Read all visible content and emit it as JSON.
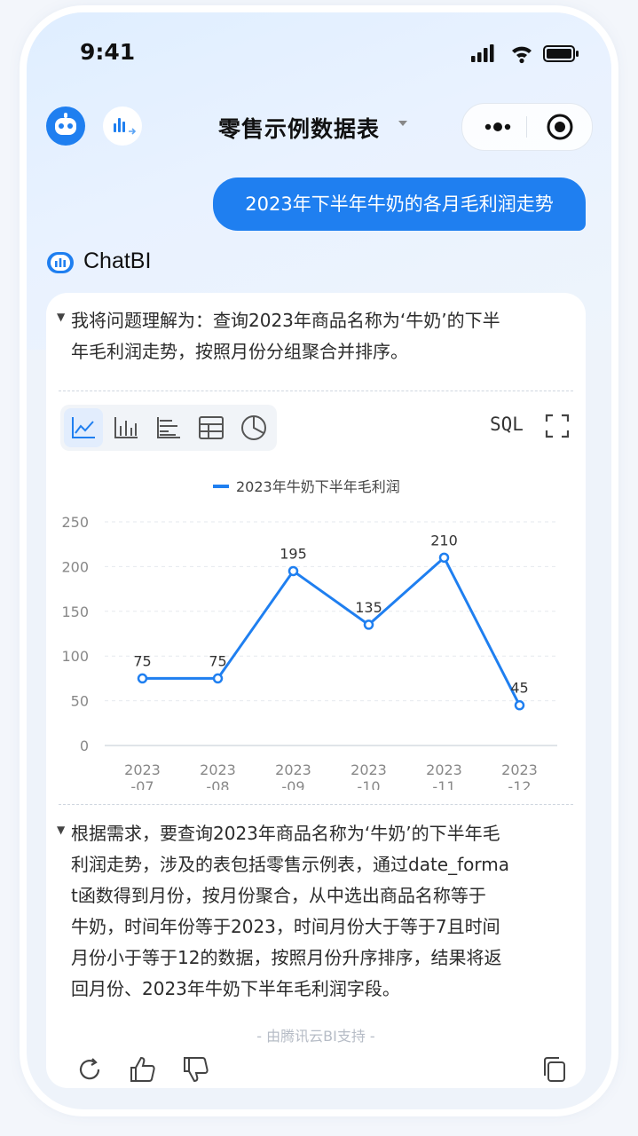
{
  "status_bar": {
    "time": "9:41"
  },
  "header": {
    "title": "零售示例数据表"
  },
  "user_message": "2023年下半年牛奶的各月毛利润走势",
  "bot": {
    "name": "ChatBI",
    "understanding": {
      "line1": "我将问题理解为：查询2023年商品名称为‘牛奶’的下半",
      "line2": "年毛利润走势，按照月份分组聚合并排序。"
    },
    "toolbar": {
      "sql_label": "SQL"
    },
    "explanation": {
      "line1": "根据需求，要查询2023年商品名称为‘牛奶’的下半年毛",
      "line2": "利润走势，涉及的表包括零售示例表，通过date_forma",
      "line3": "t函数得到月份，按月份聚合，从中选出商品名称等于",
      "line4": "牛奶，时间年份等于2023，时间月份大于等于7且时间",
      "line5": "月份小于等于12的数据，按照月份升序排序，结果将返",
      "line6": "回月份、2023年牛奶下半年毛利润字段。"
    },
    "powered_by": "- 由腾讯云BI支持 -"
  },
  "colors": {
    "accent": "#1f7ff0",
    "series": "#1f7ff0"
  },
  "icons": {
    "toolbar": [
      "line-chart-icon",
      "bar-chart-icon",
      "horizontal-bar-icon",
      "table-icon",
      "pie-chart-icon"
    ],
    "actions": [
      "refresh-icon",
      "thumbs-up-icon",
      "thumbs-down-icon",
      "copy-icon"
    ]
  },
  "chart_data": {
    "type": "line",
    "legend": "2023年牛奶下半年毛利润",
    "categories": [
      [
        "2023",
        "-07"
      ],
      [
        "2023",
        "-08"
      ],
      [
        "2023",
        "-09"
      ],
      [
        "2023",
        "-10"
      ],
      [
        "2023",
        "-11"
      ],
      [
        "2023",
        "-12"
      ]
    ],
    "series": [
      {
        "name": "2023年牛奶下半年毛利润",
        "values": [
          75,
          75,
          195,
          135,
          210,
          45
        ]
      }
    ],
    "yticks": [
      0,
      50,
      100,
      150,
      200,
      250
    ],
    "ylim": [
      0,
      250
    ],
    "grid": true,
    "legend_position": "top-center"
  }
}
